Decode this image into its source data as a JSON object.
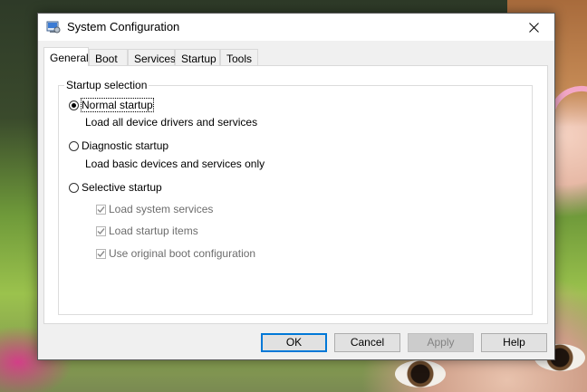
{
  "window": {
    "title": "System Configuration"
  },
  "tabs": [
    {
      "label": "General",
      "active": true
    },
    {
      "label": "Boot"
    },
    {
      "label": "Services"
    },
    {
      "label": "Startup"
    },
    {
      "label": "Tools"
    }
  ],
  "startup_selection": {
    "legend": "Startup selection",
    "normal": {
      "label": "Normal startup",
      "desc": "Load all device drivers and services",
      "checked": true
    },
    "diagnostic": {
      "label": "Diagnostic startup",
      "desc": "Load basic devices and services only",
      "checked": false
    },
    "selective": {
      "label": "Selective startup",
      "checked": false,
      "options": [
        {
          "label": "Load system services",
          "checked": true,
          "disabled": true
        },
        {
          "label": "Load startup items",
          "checked": true,
          "disabled": true
        },
        {
          "label": "Use original boot configuration",
          "checked": true,
          "disabled": true
        }
      ]
    }
  },
  "buttons": {
    "ok": "OK",
    "cancel": "Cancel",
    "apply": "Apply",
    "help": "Help"
  },
  "colors": {
    "accent": "#0078d7",
    "window_bg": "#f0f0f0",
    "disabled_text": "#6d6d6d"
  },
  "icons": {
    "app": "msconfig-icon",
    "close": "close-icon",
    "check": "checkmark-icon"
  }
}
